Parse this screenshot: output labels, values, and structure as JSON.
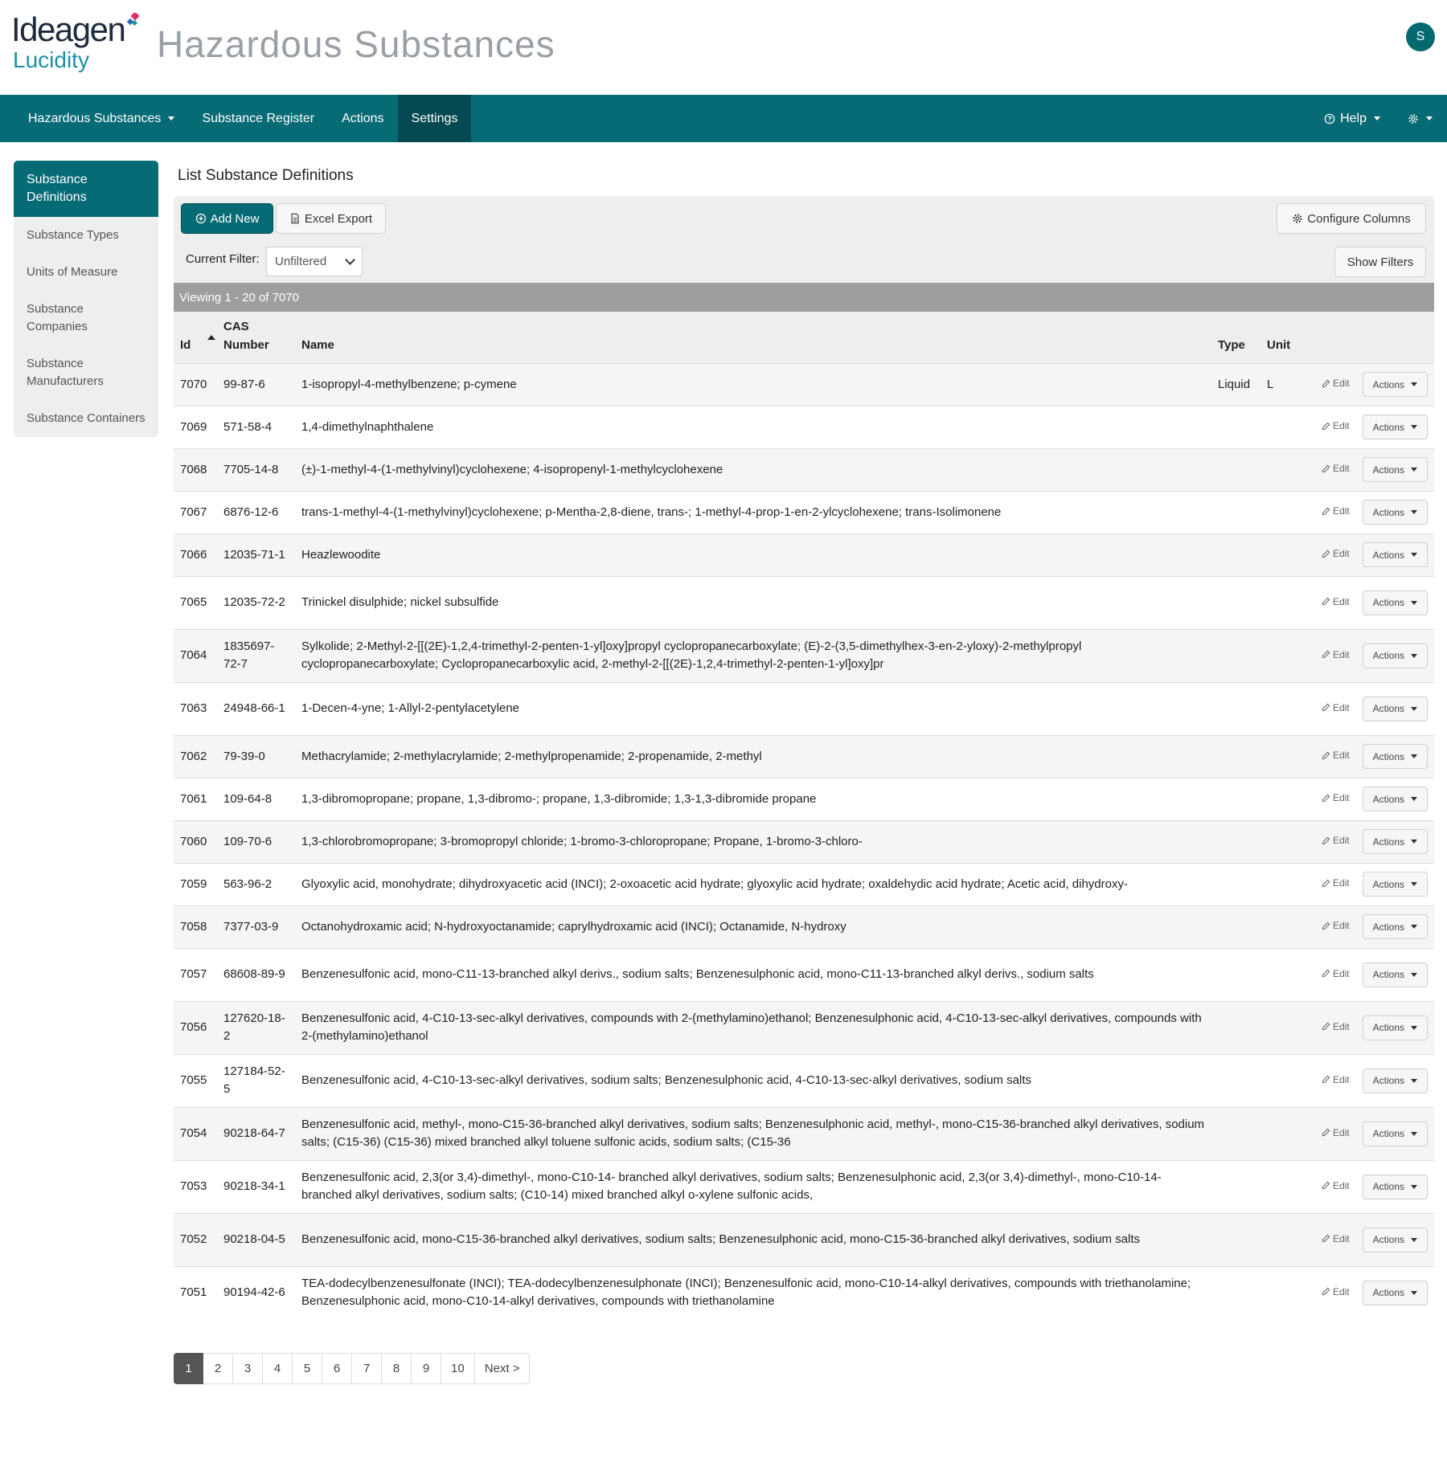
{
  "header": {
    "brand": "Ideagen",
    "product": "Lucidity",
    "app_title": "Hazardous Substances",
    "user_initial": "S"
  },
  "nav": {
    "items": [
      {
        "label": "Hazardous Substances",
        "dropdown": true
      },
      {
        "label": "Substance Register"
      },
      {
        "label": "Actions"
      },
      {
        "label": "Settings",
        "active": true
      }
    ],
    "help_label": "Help",
    "settings_icon": "gear-icon"
  },
  "sidebar": {
    "items": [
      {
        "label": "Substance Definitions",
        "active": true
      },
      {
        "label": "Substance Types"
      },
      {
        "label": "Units of Measure"
      },
      {
        "label": "Substance Companies"
      },
      {
        "label": "Substance Manufacturers"
      },
      {
        "label": "Substance Containers"
      }
    ]
  },
  "main": {
    "title": "List Substance Definitions",
    "add_new_label": "Add New",
    "excel_export_label": "Excel Export",
    "configure_columns_label": "Configure Columns",
    "show_filters_label": "Show Filters",
    "filter_label": "Current Filter:",
    "filter_value": "Unfiltered",
    "viewing_text": "Viewing 1 - 20 of 7070"
  },
  "table": {
    "columns": {
      "id": "Id",
      "cas": "CAS Number",
      "name": "Name",
      "type": "Type",
      "unit": "Unit"
    },
    "edit_label": "Edit",
    "actions_label": "Actions",
    "rows": [
      {
        "id": "7070",
        "cas": "99-87-6",
        "name": "1-isopropyl-4-methylbenzene; p-cymene",
        "type": "Liquid",
        "unit": "L"
      },
      {
        "id": "7069",
        "cas": "571-58-4",
        "name": "1,4-dimethylnaphthalene",
        "type": "",
        "unit": ""
      },
      {
        "id": "7068",
        "cas": "7705-14-8",
        "name": "(±)-1-methyl-4-(1-methylvinyl)cyclohexene; 4-isopropenyl-1-methylcyclohexene",
        "type": "",
        "unit": ""
      },
      {
        "id": "7067",
        "cas": "6876-12-6",
        "name": "trans-1-methyl-4-(1-methylvinyl)cyclohexene; p-Mentha-2,8-diene, trans-; 1-methyl-4-prop-1-en-2-ylcyclohexene; trans-Isolimonene",
        "type": "",
        "unit": ""
      },
      {
        "id": "7066",
        "cas": "12035-71-1",
        "name": "Heazlewoodite",
        "type": "",
        "unit": ""
      },
      {
        "id": "7065",
        "cas": "12035-72-2",
        "name": "Trinickel disulphide; nickel subsulfide",
        "type": "",
        "unit": ""
      },
      {
        "id": "7064",
        "cas": "1835697-72-7",
        "name": "Sylkolide; 2-Methyl-2-[[(2E)-1,2,4-trimethyl-2-penten-1-yl]oxy]propyl cyclopropanecarboxylate; (E)-2-(3,5-dimethylhex-3-en-2-yloxy)-2-methylpropyl cyclopropanecarboxylate; Cyclopropanecarboxylic acid, 2-methyl-2-[[(2E)-1,2,4-trimethyl-2-penten-1-yl]oxy]pr",
        "type": "",
        "unit": ""
      },
      {
        "id": "7063",
        "cas": "24948-66-1",
        "name": "1-Decen-4-yne; 1-Allyl-2-pentylacetylene",
        "type": "",
        "unit": ""
      },
      {
        "id": "7062",
        "cas": "79-39-0",
        "name": "Methacrylamide; 2-methylacrylamide; 2-methylpropenamide; 2-propenamide, 2-methyl",
        "type": "",
        "unit": ""
      },
      {
        "id": "7061",
        "cas": "109-64-8",
        "name": "1,3-dibromopropane; propane, 1,3-dibromo-; propane, 1,3-dibromide; 1,3-1,3-dibromide propane",
        "type": "",
        "unit": ""
      },
      {
        "id": "7060",
        "cas": "109-70-6",
        "name": "1,3-chlorobromopropane; 3-bromopropyl chloride; 1-bromo-3-chloropropane; Propane, 1-bromo-3-chloro-",
        "type": "",
        "unit": ""
      },
      {
        "id": "7059",
        "cas": "563-96-2",
        "name": "Glyoxylic acid, monohydrate; dihydroxyacetic acid (INCI); 2-oxoacetic acid hydrate; glyoxylic acid hydrate; oxaldehydic acid hydrate; Acetic acid, dihydroxy-",
        "type": "",
        "unit": ""
      },
      {
        "id": "7058",
        "cas": "7377-03-9",
        "name": "Octanohydroxamic acid; N-hydroxyoctanamide; caprylhydroxamic acid (INCI); Octanamide, N-hydroxy",
        "type": "",
        "unit": ""
      },
      {
        "id": "7057",
        "cas": "68608-89-9",
        "name": "Benzenesulfonic acid, mono-C11-13-branched alkyl derivs., sodium salts; Benzenesulphonic acid, mono-C11-13-branched alkyl derivs., sodium salts",
        "type": "",
        "unit": ""
      },
      {
        "id": "7056",
        "cas": "127620-18-2",
        "name": "Benzenesulfonic acid, 4-C10-13-sec-alkyl derivatives, compounds with 2-(methylamino)ethanol; Benzenesulphonic acid, 4-C10-13-sec-alkyl derivatives, compounds with 2-(methylamino)ethanol",
        "type": "",
        "unit": ""
      },
      {
        "id": "7055",
        "cas": "127184-52-5",
        "name": "Benzenesulfonic acid, 4-C10-13-sec-alkyl derivatives, sodium salts; Benzenesulphonic acid, 4-C10-13-sec-alkyl derivatives, sodium salts",
        "type": "",
        "unit": ""
      },
      {
        "id": "7054",
        "cas": "90218-64-7",
        "name": "Benzenesulfonic acid, methyl-, mono-C15-36-branched alkyl derivatives, sodium salts; Benzenesulphonic acid, methyl-, mono-C15-36-branched alkyl derivatives, sodium salts; (C15-36) (C15-36) mixed branched alkyl toluene sulfonic acids, sodium salts; (C15-36",
        "type": "",
        "unit": ""
      },
      {
        "id": "7053",
        "cas": "90218-34-1",
        "name": "Benzenesulfonic acid, 2,3(or 3,4)-dimethyl-, mono-C10-14- branched alkyl derivatives, sodium salts; Benzenesulphonic acid, 2,3(or 3,4)-dimethyl-, mono-C10-14-branched alkyl derivatives, sodium salts; (C10-14) mixed branched alkyl o-xylene sulfonic acids,",
        "type": "",
        "unit": ""
      },
      {
        "id": "7052",
        "cas": "90218-04-5",
        "name": "Benzenesulfonic acid, mono-C15-36-branched alkyl derivatives, sodium salts; Benzenesulphonic acid, mono-C15-36-branched alkyl derivatives, sodium salts",
        "type": "",
        "unit": ""
      },
      {
        "id": "7051",
        "cas": "90194-42-6",
        "name": "TEA-dodecylbenzenesulfonate (INCI); TEA-dodecylbenzenesulphonate (INCI); Benzenesulfonic acid, mono-C10-14-alkyl derivatives, compounds with triethanolamine; Benzenesulphonic acid, mono-C10-14-alkyl derivatives, compounds with triethanolamine",
        "type": "",
        "unit": ""
      }
    ]
  },
  "pagination": {
    "pages": [
      "1",
      "2",
      "3",
      "4",
      "5",
      "6",
      "7",
      "8",
      "9",
      "10"
    ],
    "active": "1",
    "next_label": "Next >"
  },
  "colors": {
    "primary": "#076b76",
    "primary_dark": "#054a52",
    "brand_accent": "#1f8fa4",
    "logo_mark_pink": "#d6336c"
  }
}
